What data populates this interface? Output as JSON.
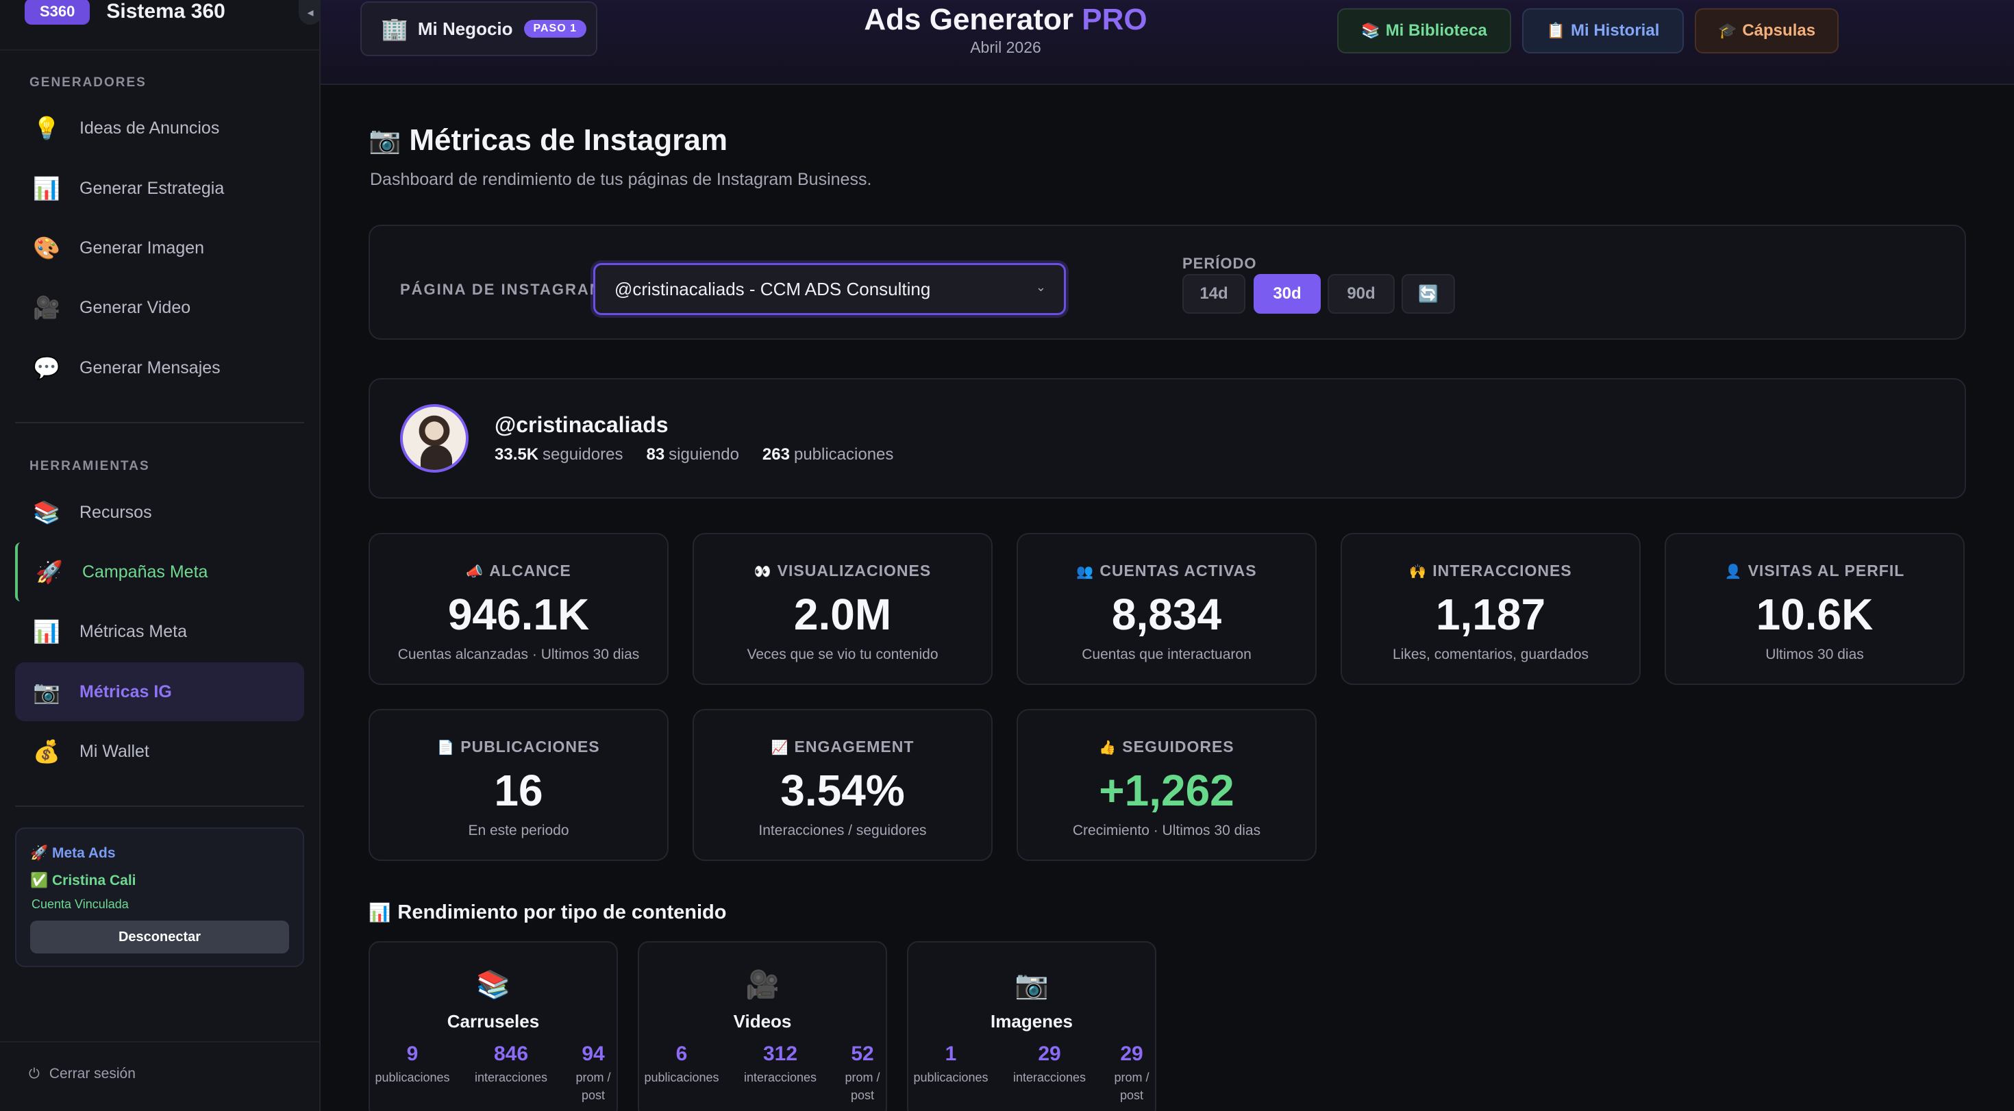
{
  "sidebar": {
    "brand_badge": "S360",
    "brand_name": "Sistema 360",
    "collapse_icon": "◂",
    "sections": {
      "generators": "GENERADORES",
      "tools": "HERRAMIENTAS"
    },
    "generators": [
      {
        "icon": "💡",
        "icon_name": "lightbulb-icon",
        "label": "Ideas de Anuncios"
      },
      {
        "icon": "📊",
        "icon_name": "bar-chart-icon",
        "label": "Generar Estrategia"
      },
      {
        "icon": "🎨",
        "icon_name": "palette-icon",
        "label": "Generar Imagen"
      },
      {
        "icon": "🎥",
        "icon_name": "video-camera-icon",
        "label": "Generar Video"
      },
      {
        "icon": "💬",
        "icon_name": "speech-bubble-icon",
        "label": "Generar Mensajes"
      }
    ],
    "tools": [
      {
        "icon": "📚",
        "icon_name": "books-icon",
        "label": "Recursos"
      },
      {
        "icon": "🚀",
        "icon_name": "rocket-icon",
        "label": "Campañas Meta"
      },
      {
        "icon": "📊",
        "icon_name": "bar-chart-icon",
        "label": "Métricas Meta"
      },
      {
        "icon": "📷",
        "icon_name": "camera-icon",
        "label": "Métricas IG",
        "active": true
      },
      {
        "icon": "💰",
        "icon_name": "money-bag-icon",
        "label": "Mi Wallet"
      }
    ],
    "meta_card": {
      "title": "🚀 Meta Ads",
      "user": "✅ Cristina Cali",
      "status": "Cuenta Vinculada",
      "disconnect_label": "Desconectar"
    },
    "logout_icon": "⏻",
    "logout_label": "Cerrar sesión"
  },
  "header": {
    "business_icon": "🏢",
    "business_label": "Mi Negocio",
    "step_badge": "PASO 1",
    "title_main": "Ads Generator ",
    "title_accent": "PRO",
    "subtitle": "Abril 2026",
    "buttons": {
      "library": {
        "icon": "📚",
        "label": "Mi Biblioteca"
      },
      "history": {
        "icon": "📋",
        "label": "Mi Historial"
      },
      "capsules": {
        "icon": "🎓",
        "label": "Cápsulas"
      }
    }
  },
  "main": {
    "title_icon": "📷",
    "title": "Métricas de Instagram",
    "subtitle": "Dashboard de rendimiento de tus páginas de Instagram Business.",
    "filters": {
      "page_label": "PÁGINA DE INSTAGRAM",
      "page_value": "@cristinacaliads - CCM ADS Consulting",
      "period_label": "PERÍODO",
      "periods": [
        "14d",
        "30d",
        "90d"
      ],
      "period_selected": "30d",
      "refresh_icon": "🔄"
    },
    "profile": {
      "handle": "@cristinacaliads",
      "followers": "33.5K",
      "followers_label": "seguidores",
      "following": "83",
      "following_label": "siguiendo",
      "posts": "263",
      "posts_label": "publicaciones"
    },
    "metrics": [
      {
        "icon": "📣",
        "label": "ALCANCE",
        "value": "946.1K",
        "desc": "Cuentas alcanzadas · Ultimos 30 dias"
      },
      {
        "icon": "👀",
        "label": "VISUALIZACIONES",
        "value": "2.0M",
        "desc": "Veces que se vio tu contenido"
      },
      {
        "icon": "👥",
        "label": "CUENTAS ACTIVAS",
        "value": "8,834",
        "desc": "Cuentas que interactuaron"
      },
      {
        "icon": "🙌",
        "label": "INTERACCIONES",
        "value": "1,187",
        "desc": "Likes, comentarios, guardados"
      },
      {
        "icon": "👤",
        "label": "VISITAS AL PERFIL",
        "value": "10.6K",
        "desc": "Ultimos 30 dias"
      },
      {
        "icon": "📄",
        "label": "PUBLICACIONES",
        "value": "16",
        "desc": "En este periodo"
      },
      {
        "icon": "📈",
        "label": "ENGAGEMENT",
        "value": "3.54%",
        "desc": "Interacciones / seguidores"
      },
      {
        "icon": "👍",
        "label": "SEGUIDORES",
        "value": "+1,262",
        "desc": "Crecimiento · Ultimos 30 dias",
        "positive_color": "#67d98a"
      }
    ],
    "content_section_icon": "📊",
    "content_section_title": "Rendimiento por tipo de contenido",
    "content_types": [
      {
        "icon": "📚",
        "name": "Carruseles",
        "posts": "9",
        "interactions": "846",
        "avg": "94"
      },
      {
        "icon": "🎥",
        "name": "Videos",
        "posts": "6",
        "interactions": "312",
        "avg": "52"
      },
      {
        "icon": "📷",
        "name": "Imagenes",
        "posts": "1",
        "interactions": "29",
        "avg": "29"
      }
    ],
    "content_labels": {
      "posts": "publicaciones",
      "interactions": "interacciones",
      "avg": "prom / post"
    }
  },
  "colors": {
    "accent": "#7b5cf0",
    "positive": "#67d98a",
    "background": "#0d0e12"
  }
}
